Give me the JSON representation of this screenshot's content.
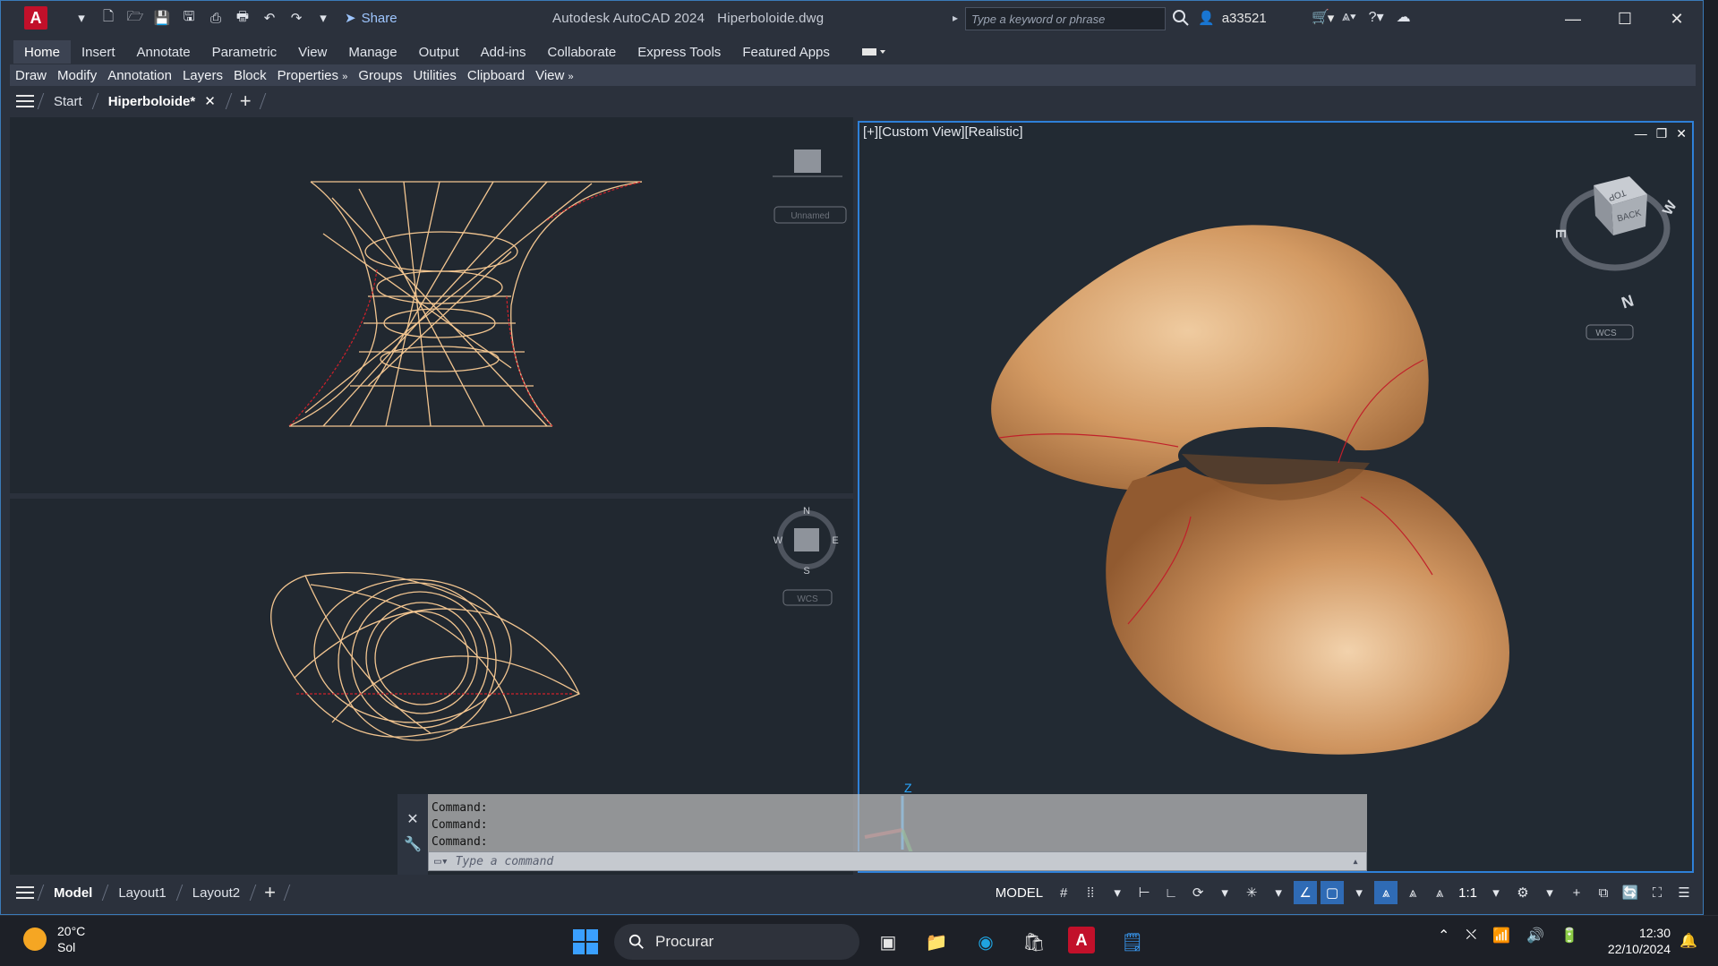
{
  "window": {
    "app_title": "Autodesk AutoCAD 2024",
    "file_title": "Hiperboloide.dwg",
    "share_label": "Share",
    "search_placeholder": "Type a keyword or phrase",
    "username": "a33521"
  },
  "ribbon": {
    "tabs": [
      "Home",
      "Insert",
      "Annotate",
      "Parametric",
      "View",
      "Manage",
      "Output",
      "Add-ins",
      "Collaborate",
      "Express Tools",
      "Featured Apps"
    ],
    "active_tab": "Home",
    "panels": [
      "Draw",
      "Modify",
      "Annotation",
      "Layers",
      "Block",
      "Properties",
      "Groups",
      "Utilities",
      "Clipboard",
      "View"
    ]
  },
  "file_tabs": {
    "start_label": "Start",
    "active_file": "Hiperboloide*"
  },
  "viewports": {
    "right_label": "[+][Custom View][Realistic]",
    "top_unnamed": "Unnamed",
    "wcs": "WCS",
    "viewcube_top": "TOP",
    "viewcube_back": "BACK",
    "compass": {
      "n": "N",
      "s": "S",
      "e": "E",
      "w": "W"
    },
    "axis_z": "Z"
  },
  "command_line": {
    "history": [
      "Command:",
      "Command:",
      "Command:"
    ],
    "placeholder": "Type a command"
  },
  "layouts": [
    "Model",
    "Layout1",
    "Layout2"
  ],
  "status": {
    "model_label": "MODEL",
    "scale": "1:1"
  },
  "taskbar": {
    "temperature": "20°C",
    "weather": "Sol",
    "search_label": "Procurar",
    "time": "12:30",
    "date": "22/10/2024"
  },
  "colors": {
    "accent": "#2e80d8",
    "wire": "#f2c590",
    "edge_red": "#d0202a",
    "surface": "#d9a06a"
  }
}
